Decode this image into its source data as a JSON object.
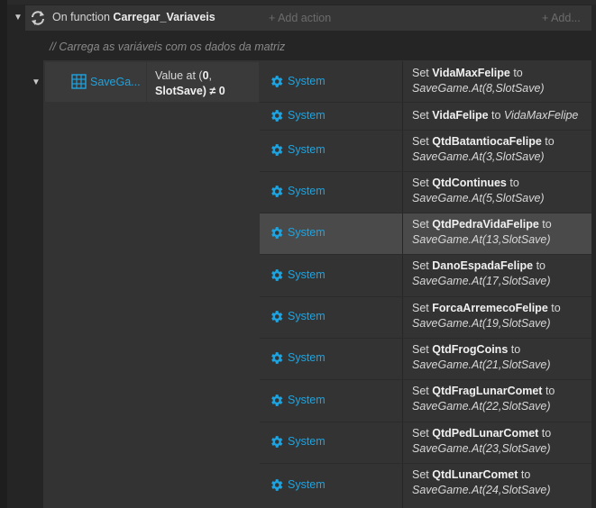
{
  "function_event": {
    "prefix": "On function",
    "name": "Carregar_Variaveis",
    "add_action": "+ Add action",
    "add_right": "+ Add..."
  },
  "comment": "// Carrega as variáveis com os dados da matriz",
  "event": {
    "object_name": "SaveGa...",
    "condition": {
      "line1_pre": "Value at (",
      "line1_bold": "0",
      "line1_post": ",",
      "line2_bold": "SlotSave)",
      "line2_post": " ≠ 0"
    }
  },
  "actions": [
    {
      "object": "System",
      "pre": "Set ",
      "var": "VidaMaxFelipe",
      "mid": " to",
      "expr": "SaveGame.At(8,SlotSave)"
    },
    {
      "object": "System",
      "pre": "Set ",
      "var": "VidaFelipe",
      "mid": " to ",
      "expr": "VidaMaxFelipe"
    },
    {
      "object": "System",
      "pre": "Set ",
      "var": "QtdBatantiocaFelipe",
      "mid": " to",
      "expr": "SaveGame.At(3,SlotSave)"
    },
    {
      "object": "System",
      "pre": "Set ",
      "var": "QtdContinues",
      "mid": " to ",
      "expr": "SaveGame.At(5,SlotSave)"
    },
    {
      "object": "System",
      "pre": "Set ",
      "var": "QtdPedraVidaFelipe",
      "mid": " to",
      "expr": "SaveGame.At(13,SlotSave)",
      "highlight": true
    },
    {
      "object": "System",
      "pre": "Set ",
      "var": "DanoEspadaFelipe",
      "mid": " to",
      "expr": "SaveGame.At(17,SlotSave)"
    },
    {
      "object": "System",
      "pre": "Set ",
      "var": "ForcaArremecoFelipe",
      "mid": " to",
      "expr": "SaveGame.At(19,SlotSave)"
    },
    {
      "object": "System",
      "pre": "Set ",
      "var": "QtdFrogCoins",
      "mid": " to ",
      "expr": "SaveGame.At(21,SlotSave)"
    },
    {
      "object": "System",
      "pre": "Set ",
      "var": "QtdFragLunarComet",
      "mid": " to",
      "expr": "SaveGame.At(22,SlotSave)"
    },
    {
      "object": "System",
      "pre": "Set ",
      "var": "QtdPedLunarComet",
      "mid": " to",
      "expr": "SaveGame.At(23,SlotSave)"
    },
    {
      "object": "System",
      "pre": "Set ",
      "var": "QtdLunarComet",
      "mid": " to",
      "expr": "SaveGame.At(24,SlotSave)"
    }
  ],
  "colors": {
    "object_link": "#1ea4e0",
    "background": "#252525",
    "event_block": "#333333",
    "highlight_row": "#4a4a4a"
  },
  "icons": {
    "toggle": "triangle-down-icon",
    "function": "function-loop-icon",
    "object": "grid-array-icon",
    "system": "gear-icon"
  }
}
